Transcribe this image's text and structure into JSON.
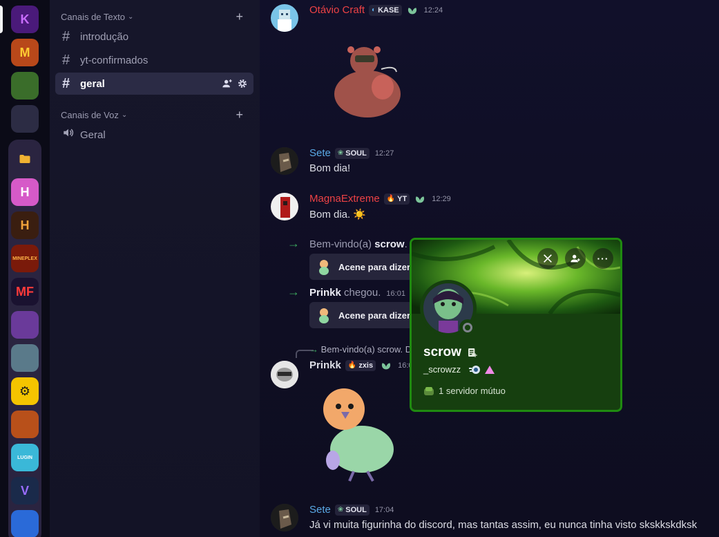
{
  "servers": {
    "top": [
      {
        "name": "Kingdome",
        "icon": "K",
        "bg": "#4a1a7a",
        "fg": "#c86dff"
      },
      {
        "name": "M server",
        "icon": "M",
        "bg": "#b8481a",
        "fg": "#ffcc33"
      },
      {
        "name": "Minecraft server",
        "icon": "",
        "bg": "#3a6d2a",
        "fg": "#ffffff"
      },
      {
        "name": "Mixed server",
        "icon": "",
        "bg": "#2c2c44",
        "fg": "#ffffff"
      }
    ],
    "folder": [
      {
        "name": "H server",
        "icon": "H",
        "bg": "#d65ac8",
        "fg": "#ffffff"
      },
      {
        "name": "H dark server",
        "icon": "H",
        "bg": "#3a1e10",
        "fg": "#f2a33a"
      },
      {
        "name": "Mineplex",
        "icon": "MINEPLEX",
        "bg": "#7a1a0a",
        "fg": "#ffb347"
      },
      {
        "name": "MF server",
        "icon": "MF",
        "bg": "#1a1230",
        "fg": "#ff3a3a"
      },
      {
        "name": "Purple face server",
        "icon": "",
        "bg": "#6a3a9a",
        "fg": "#ffffff"
      },
      {
        "name": "Landscape server",
        "icon": "",
        "bg": "#5a7a8a",
        "fg": "#ffffff"
      },
      {
        "name": "Gear server",
        "icon": "⚙",
        "bg": "#f5c400",
        "fg": "#1a1a1a"
      },
      {
        "name": "Pumpkin server",
        "icon": "",
        "bg": "#b8501a",
        "fg": "#ffffff"
      },
      {
        "name": "Lugin",
        "icon": "LUGIN",
        "bg": "#3ab8d8",
        "fg": "#ffffff"
      },
      {
        "name": "V server",
        "icon": "V",
        "bg": "#1a2a4a",
        "fg": "#9a6dff"
      },
      {
        "name": "Blue server",
        "icon": "",
        "bg": "#2a6ad8",
        "fg": "#ffffff"
      }
    ]
  },
  "sidebar": {
    "text_category": "Canais de Texto",
    "voice_category": "Canais de Voz",
    "text_channels": [
      "introdução",
      "yt-confirmados",
      "geral"
    ],
    "voice_channels": [
      "Geral"
    ]
  },
  "messages": {
    "m1": {
      "user": "Otávio Craft",
      "tag": "KASE",
      "time": "12:24",
      "color": "#ed4245"
    },
    "m2": {
      "user": "Sete",
      "tag": "SOUL",
      "time": "12:27",
      "text": "Bom dia!",
      "color": "#5aa9e6"
    },
    "m3": {
      "user": "MagnaExtreme",
      "tag": "YT",
      "time": "12:29",
      "text": "Bom dia. ☀️",
      "color": "#ed4245"
    },
    "s1": {
      "prefix": "Bem-vindo(a) ",
      "user": "scrow",
      "suffix": ".",
      "button": "Acene para dizer"
    },
    "s2": {
      "user": "Prinkk",
      "text": " chegou.",
      "time": "16:01",
      "button": "Acene para dizer"
    },
    "m4": {
      "reply": "Bem-vindo(a) scrow. D",
      "user": "Prinkk",
      "tag": "zxis",
      "time": "16:0",
      "color": "#dcdde5"
    },
    "m5": {
      "user": "Sete",
      "tag": "SOUL",
      "time": "17:04",
      "text": "Já vi muita figurinha do discord, mas tantas assim, eu nunca tinha visto skskkskdksk",
      "color": "#5aa9e6"
    }
  },
  "popout": {
    "display_name": "scrow",
    "username": "_scrowzz",
    "mutual": "1 servidor mútuo",
    "accent": "#1f8a10"
  }
}
